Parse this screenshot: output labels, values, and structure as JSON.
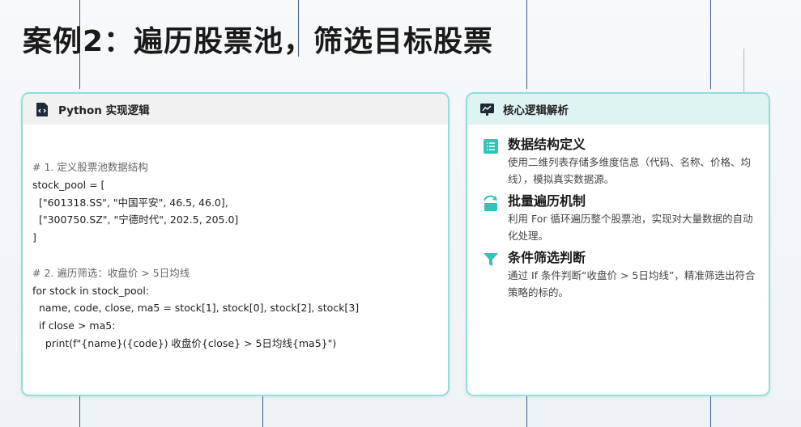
{
  "page_title": "案例2：遍历股票池，筛选目标股票",
  "left_card": {
    "header": "Python 实现逻辑",
    "icon": "code-file-icon",
    "code_lines": [
      {
        "text": "# 1. 定义股票池数据结构",
        "comment": true
      },
      {
        "text": "stock_pool = [",
        "comment": false
      },
      {
        "text": "  [\"601318.SS\", \"中国平安\", 46.5, 46.0],",
        "comment": false
      },
      {
        "text": "  [\"300750.SZ\", \"宁德时代\", 202.5, 205.0]",
        "comment": false
      },
      {
        "text": "]",
        "comment": false
      },
      {
        "text": "",
        "comment": false
      },
      {
        "text": "# 2. 遍历筛选：收盘价 > 5日均线",
        "comment": true
      },
      {
        "text": "for stock in stock_pool:",
        "comment": false
      },
      {
        "text": "  name, code, close, ma5 = stock[1], stock[0], stock[2], stock[3]",
        "comment": false
      },
      {
        "text": "  if close > ma5:",
        "comment": false
      },
      {
        "text": "    print(f\"{name}({code}) 收盘价{close} > 5日均线{ma5}\")",
        "comment": false
      }
    ]
  },
  "right_card": {
    "header": "核心逻辑解析",
    "icon": "chart-board-icon",
    "items": [
      {
        "icon": "list-icon",
        "title": "数据结构定义",
        "desc": "使用二维列表存储多维度信息（代码、名称、价格、均线），模拟真实数据源。"
      },
      {
        "icon": "loop-icon",
        "title": "批量遍历机制",
        "desc": "利用 For 循环遍历整个股票池，实现对大量数据的自动化处理。"
      },
      {
        "icon": "filter-icon",
        "title": "条件筛选判断",
        "desc": "通过 If 条件判断“收盘价 > 5日均线”，精准筛选出符合策略的标的。"
      }
    ]
  },
  "colors": {
    "accent": "#2ec4b6",
    "border": "#8fded8",
    "icon_dark": "#1e2a3a"
  }
}
